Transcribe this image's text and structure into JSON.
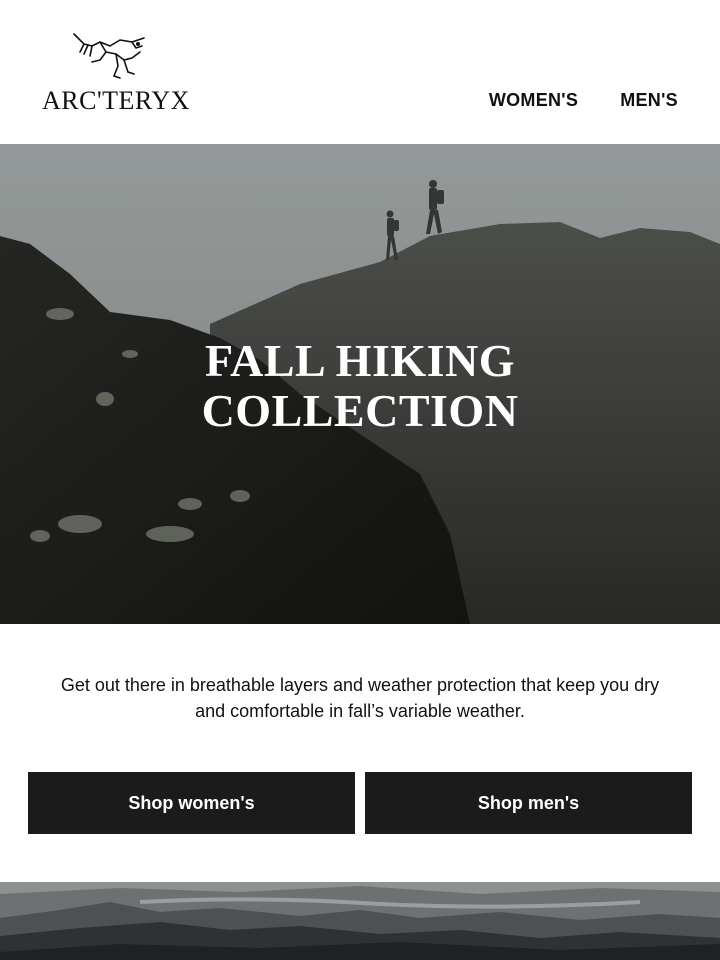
{
  "brand": {
    "logo_icon": "archaeopteryx-logo-icon",
    "wordmark": "ARC'TERYX"
  },
  "nav": {
    "items": [
      {
        "label": "WOMEN'S"
      },
      {
        "label": "MEN'S"
      }
    ]
  },
  "hero": {
    "title_line1": "FALL HIKING",
    "title_line2": "COLLECTION"
  },
  "intro": {
    "text": "Get out there in breathable layers and weather protection that keep you dry and comfortable in fall’s variable weather."
  },
  "buttons": {
    "shop_women": "Shop women's",
    "shop_men": "Shop men's"
  },
  "colors": {
    "button_bg": "#1b1b1b",
    "text": "#111111",
    "background": "#ffffff"
  }
}
